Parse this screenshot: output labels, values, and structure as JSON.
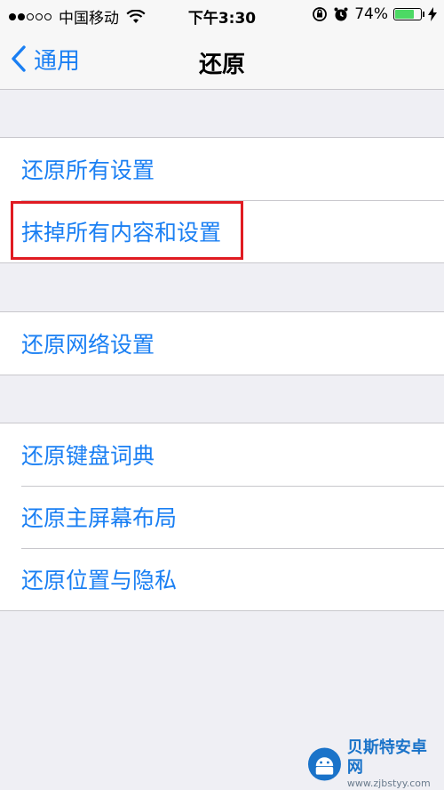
{
  "status_bar": {
    "signal_full": 2,
    "signal_total": 5,
    "carrier": "中国移动",
    "time": "下午3:30",
    "battery_percent_text": "74%",
    "battery_level": 0.74,
    "battery_color": "#4cd964",
    "icons": [
      "wifi-icon",
      "orientation-lock-icon",
      "alarm-icon",
      "battery-icon",
      "charging-bolt-icon"
    ]
  },
  "nav": {
    "back_label": "通用",
    "title": "还原"
  },
  "accent_color": "#1a7ff3",
  "highlight_color": "#e01b22",
  "groups": [
    {
      "items": [
        "还原所有设置",
        "抹掉所有内容和设置"
      ]
    },
    {
      "items": [
        "还原网络设置"
      ]
    },
    {
      "items": [
        "还原键盘词典",
        "还原主屏幕布局",
        "还原位置与隐私"
      ]
    }
  ],
  "highlighted_item": "抹掉所有内容和设置",
  "watermark": {
    "title": "贝斯特安卓网",
    "url": "www.zjbstyy.com"
  }
}
